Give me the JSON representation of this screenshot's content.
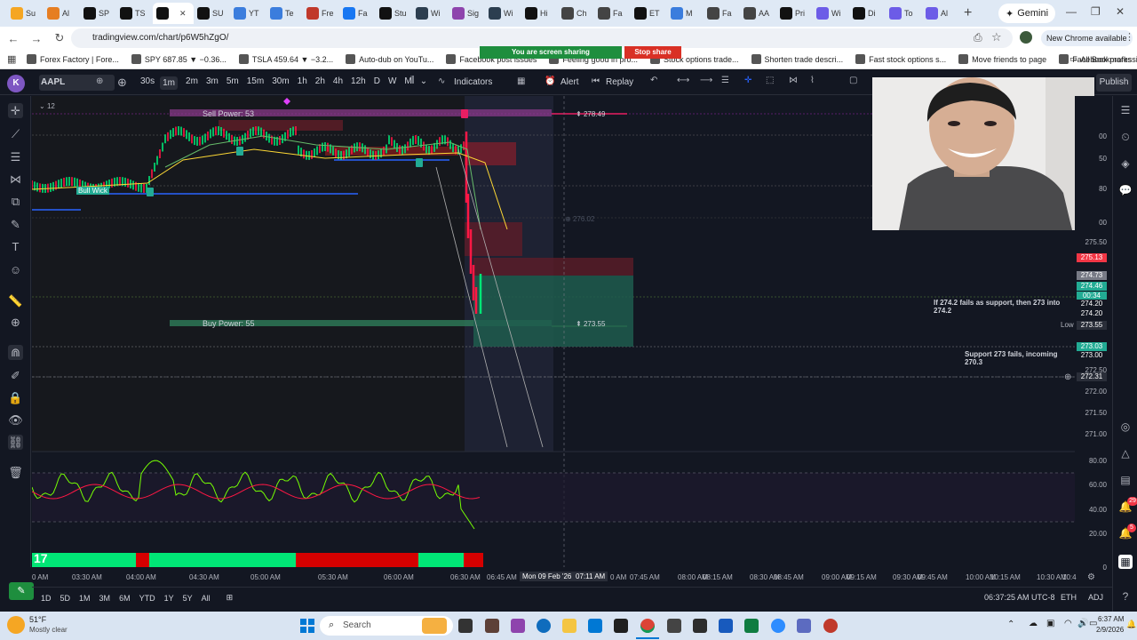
{
  "browser": {
    "tabs": [
      "Su",
      "Al",
      "SP",
      "TS",
      "",
      "SU",
      "YT",
      "Te",
      "Fre",
      "Fa",
      "Stu",
      "Wi",
      "Sig",
      "Wi",
      "Hi",
      "Ch",
      "Fa",
      "ET",
      "M",
      "Fa",
      "AA",
      "Pri",
      "Wi",
      "Di",
      "To",
      "Al"
    ],
    "gemini_label": "Gemini",
    "url": "tradingview.com/chart/p6W5hZgO/",
    "chrome_available": "New Chrome available",
    "screen_sharing": "You are screen sharing",
    "stop_share": "Stop share",
    "bookmarks": [
      "Forex Factory | Fore...",
      "SPY 687.85 ▼ −0.36...",
      "TSLA 459.64 ▼ −3.2...",
      "Auto-dub on YouTu...",
      "Facebook post issues",
      "Feeling good in pro...",
      "Stock options trade...",
      "Shorten trade descri...",
      "Fast stock options s...",
      "Move friends to page",
      "Facebook professio..."
    ],
    "all_bookmarks": "All Bookmarks"
  },
  "toolbar": {
    "symbol": "AAPL",
    "timeframes": [
      "30s",
      "1m",
      "2m",
      "3m",
      "5m",
      "15m",
      "30m",
      "1h",
      "2h",
      "4h",
      "12h",
      "D",
      "W",
      "M"
    ],
    "active_timeframe": "1m",
    "indicators": "Indicators",
    "alert": "Alert",
    "replay": "Replay",
    "publish": "Publish",
    "layout_count": "12"
  },
  "chart": {
    "sell_power": "Sell Power: 53",
    "buy_power": "Buy Power: 55",
    "bull_wick": "Bull Wick",
    "level_high": "278.49",
    "level_low": "273.55",
    "faded_level": "276.02",
    "note_1": "If 274.2 fails as support, then 273 into 274.2",
    "note_2": "Support 273 fails, incoming 270.3",
    "low_label": "Low",
    "crosshair_date": "Mon 09 Feb '26",
    "crosshair_time": "07:11 AM"
  },
  "price_axis": {
    "ticks": [
      "00",
      "50",
      "80",
      "00",
      "275.50",
      "273.00",
      "272.50",
      "272.00",
      "271.50",
      "271.00",
      "80.00",
      "60.00",
      "40.00",
      "20.00",
      "0"
    ],
    "badges": [
      {
        "label": "275.13",
        "color": "#f23645"
      },
      {
        "label": "274.73",
        "color": "#787b86"
      },
      {
        "label": "274.46",
        "color": "#22ab94"
      },
      {
        "label": "00:34",
        "color": "#22ab94"
      },
      {
        "label": "274.20",
        "color": "#131722"
      },
      {
        "label": "274.20",
        "color": "#131722"
      },
      {
        "label": "273.55",
        "color": "#2a2e39"
      },
      {
        "label": "273.03",
        "color": "#22ab94"
      },
      {
        "label": "273.00",
        "color": "#131722"
      },
      {
        "label": "272.31",
        "color": "#2a2e39"
      }
    ]
  },
  "time_axis": [
    "0 AM",
    "03:30 AM",
    "04:00 AM",
    "04:30 AM",
    "05:00 AM",
    "05:30 AM",
    "06:00 AM",
    "06:30 AM",
    "06:45 AM",
    "0 AM",
    "07:45 AM",
    "08:00 AM",
    "08:15 AM",
    "08:30 AM",
    "08:45 AM",
    "09:00 AM",
    "09:15 AM",
    "09:30 AM",
    "09:45 AM",
    "10:00 AM",
    "10:15 AM",
    "10:30 AM",
    "10:4"
  ],
  "bottom": {
    "ranges": [
      "1D",
      "5D",
      "1M",
      "3M",
      "6M",
      "YTD",
      "1Y",
      "5Y",
      "All"
    ],
    "clock": "06:37:25 AM UTC-8",
    "session": "ETH",
    "adj": "ADJ"
  },
  "taskbar": {
    "weather_temp": "51°F",
    "weather_desc": "Mostly clear",
    "search_placeholder": "Search",
    "time": "6:37 AM",
    "date": "2/9/2026"
  },
  "right_badges": [
    "29",
    "5"
  ]
}
